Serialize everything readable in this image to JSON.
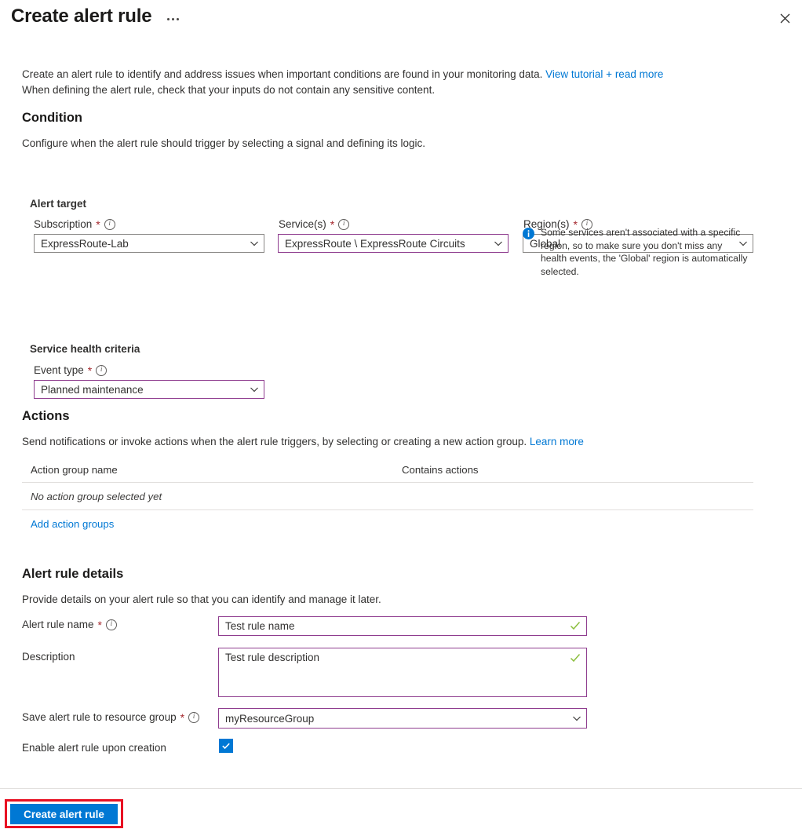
{
  "header": {
    "title": "Create alert rule",
    "ellipsis_label": "...",
    "close_label": "close-icon"
  },
  "intro": {
    "line1_prefix": "Create an alert rule to identify and address issues when important conditions are found in your monitoring data. ",
    "line1_link": "View tutorial + read more",
    "line2": "When defining the alert rule, check that your inputs do not contain any sensitive content."
  },
  "condition": {
    "heading": "Condition",
    "description": "Configure when the alert rule should trigger by selecting a signal and defining its logic.",
    "alert_target_heading": "Alert target",
    "subscription": {
      "label": "Subscription",
      "required": "*",
      "value": "ExpressRoute-Lab"
    },
    "services": {
      "label": "Service(s)",
      "required": "*",
      "value": "ExpressRoute \\ ExpressRoute Circuits"
    },
    "regions": {
      "label": "Region(s)",
      "required": "*",
      "value": "Global"
    },
    "region_info": "Some services aren't associated with a specific region, so to make sure you don't miss any health events, the 'Global' region is automatically selected.",
    "service_health_heading": "Service health criteria",
    "event_type": {
      "label": "Event type",
      "required": "*",
      "value": "Planned maintenance"
    }
  },
  "actions": {
    "heading": "Actions",
    "description_prefix": "Send notifications or invoke actions when the alert rule triggers, by selecting or creating a new action group. ",
    "description_link": "Learn more",
    "columns": [
      "Action group name",
      "Contains actions"
    ],
    "empty_row": "No action group selected yet",
    "add_link": "Add action groups"
  },
  "alert_rule_details": {
    "heading": "Alert rule details",
    "description": "Provide details on your alert rule so that you can identify and manage it later.",
    "rule_name": {
      "label": "Alert rule name",
      "required": "*",
      "value": "Test rule name"
    },
    "rule_description": {
      "label": "Description",
      "value": "Test rule description"
    },
    "resource_group": {
      "label": "Save alert rule to resource group",
      "required": "*",
      "value": "myResourceGroup"
    },
    "enable_on_creation": {
      "label": "Enable alert rule upon creation",
      "checked": "true"
    }
  },
  "footer": {
    "create_button": "Create alert rule"
  },
  "colors": {
    "accent_blue": "#0078d4",
    "field_accent": "#8f3d8f",
    "required_red": "#a4262c",
    "highlight_red": "#e81123",
    "valid_green": "#8cbf3f"
  }
}
